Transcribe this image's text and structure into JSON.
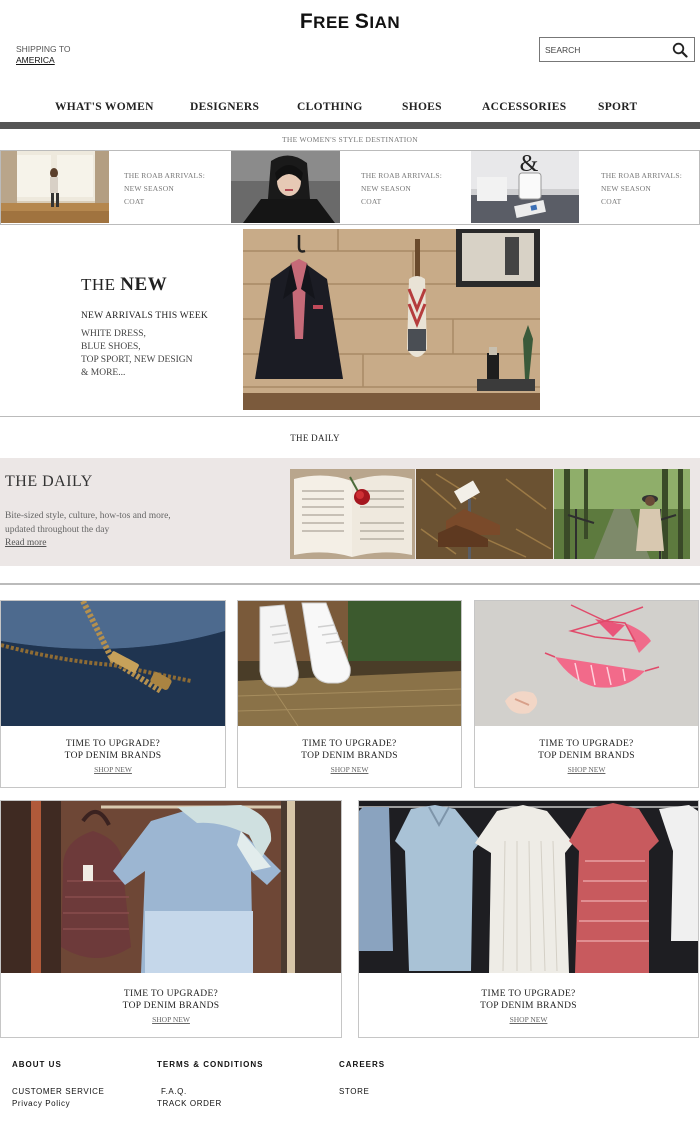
{
  "brand": {
    "logo_a": "F",
    "logo_b": "REE ",
    "logo_c": "S",
    "logo_d": "IAN"
  },
  "shipping": {
    "label": "SHIPPING TO",
    "country": "AMERICA"
  },
  "search": {
    "placeholder": "SEARCH"
  },
  "nav": [
    "WHAT'S WOMEN",
    "DESIGNERS",
    "CLOTHING",
    "SHOES",
    "ACCESSORIES",
    "SPORT"
  ],
  "tagline": "THE WOMEN'S STYLE DESTINATION",
  "arrivals": [
    {
      "line1": "THE ROAB ARRIVALS:",
      "line2": "NEW SEASON",
      "line3": "COAT"
    },
    {
      "line1": "THE ROAB ARRIVALS:",
      "line2": "NEW SEASON",
      "line3": "COAT"
    },
    {
      "line1": "THE ROAB ARRIVALS:",
      "line2": "NEW SEASON",
      "line3": "COAT"
    }
  ],
  "hero": {
    "the": "THE ",
    "new": "NEW",
    "subtitle": "NEW ARRIVALS THIS WEEK",
    "items": [
      "WHITE DRESS,",
      "BLUE SHOES,",
      "TOP SPORT, NEW DESIGN",
      "& MORE..."
    ]
  },
  "daily_heading": "THE DAILY",
  "daily": {
    "title": "THE DAILY",
    "text1": "Bite-sized style, culture, how-tos and more,",
    "text2": "updated throughout the day",
    "read_more": "Read more"
  },
  "cards": [
    {
      "line1": "TIME TO UPGRADE?",
      "line2": "TOP DENIM BRANDS",
      "cta": "SHOP NEW"
    },
    {
      "line1": "TIME TO UPGRADE?",
      "line2": "TOP DENIM BRANDS",
      "cta": "SHOP NEW"
    },
    {
      "line1": "TIME TO UPGRADE?",
      "line2": "TOP DENIM BRANDS",
      "cta": "SHOP NEW"
    },
    {
      "line1": "TIME TO UPGRADE?",
      "line2": "TOP DENIM BRANDS",
      "cta": "SHOP NEW"
    },
    {
      "line1": "TIME TO UPGRADE?",
      "line2": "TOP DENIM BRANDS",
      "cta": "SHOP NEW"
    }
  ],
  "footer": {
    "about": "ABOUT US",
    "terms": "TERMS & CONDITIONS",
    "careers": "CAREERS",
    "customer_service": "CUSTOMER SERVICE",
    "privacy": "Privacy Policy",
    "faq": "F.A.Q.",
    "track": "TRACK ORDER",
    "store": "STORE"
  },
  "colors": {
    "nav_bar": "#555555",
    "daily_band": "#ece7e6",
    "border": "#bbbbbb"
  },
  "icons": [
    "search-icon"
  ]
}
